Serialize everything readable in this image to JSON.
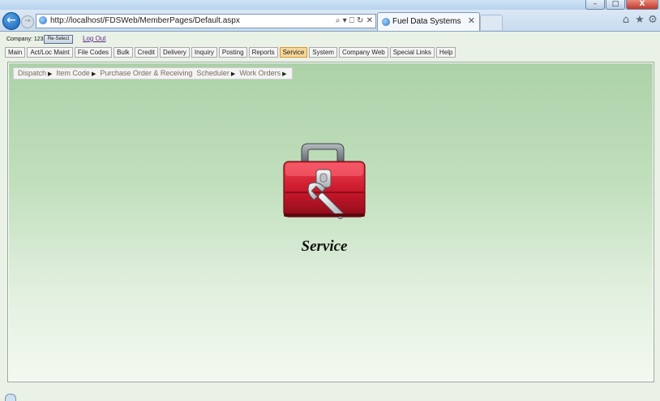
{
  "browser": {
    "address_url": "http://localhost/FDSWeb/MemberPages/Default.aspx",
    "tab_title": "Fuel Data Systems",
    "address_tools": "⌕ ▾ ⎕ ↻ ✕",
    "tab_close": "✕",
    "window_buttons": {
      "minimize": "–",
      "maximize": "□",
      "close": "X"
    },
    "back": "←",
    "forward": "→",
    "home_icon": "⌂",
    "favorites_icon": "★",
    "tools_icon": "⚙"
  },
  "header": {
    "company_label": "Company: 123",
    "reselect_label": "Re-Select",
    "logout_label": "Log Out"
  },
  "menu": {
    "items": [
      {
        "label": "Main"
      },
      {
        "label": "Act/Loc Maint"
      },
      {
        "label": "File Codes"
      },
      {
        "label": "Bulk"
      },
      {
        "label": "Credit"
      },
      {
        "label": "Delivery"
      },
      {
        "label": "Inquiry"
      },
      {
        "label": "Posting"
      },
      {
        "label": "Reports"
      },
      {
        "label": "Service"
      },
      {
        "label": "System"
      },
      {
        "label": "Company Web"
      },
      {
        "label": "Special Links"
      },
      {
        "label": "Help"
      }
    ],
    "active": "Service"
  },
  "submenu": {
    "items": [
      {
        "label": "Dispatch"
      },
      {
        "label": "Item Code"
      },
      {
        "label": "Purchase Order & Receiving"
      },
      {
        "label": "Scheduler"
      },
      {
        "label": "Work Orders"
      }
    ],
    "arrow": "▶"
  },
  "main": {
    "heading": "Service",
    "icon": "toolbox-wrench-icon"
  },
  "colors": {
    "active_tab": "#f6d79a",
    "panel_top": "#acd1a8",
    "panel_bottom": "#f3f9f1",
    "toolbox_red": "#c0192b",
    "logout_link": "#5b2a86"
  }
}
